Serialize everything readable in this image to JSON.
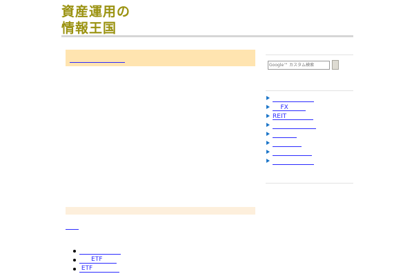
{
  "site": {
    "title_line1": "資産運用の",
    "title_line2": "情報王国"
  },
  "search": {
    "placeholder": "Google™ カスタム検索",
    "button_label": ""
  },
  "main": {
    "banner_link": "",
    "section_link": "",
    "list": [
      "",
      "      ETF",
      " ETF"
    ]
  },
  "sidebar": {
    "items": [
      "",
      "    FX",
      "REIT",
      "",
      "",
      "",
      "",
      ""
    ]
  },
  "colors": {
    "title": "#9a9210",
    "banner": "#ffe4b0",
    "section_bar": "#fdefdc",
    "link": "#2a2aff",
    "sidebar_arrow": "#1a74c8"
  }
}
